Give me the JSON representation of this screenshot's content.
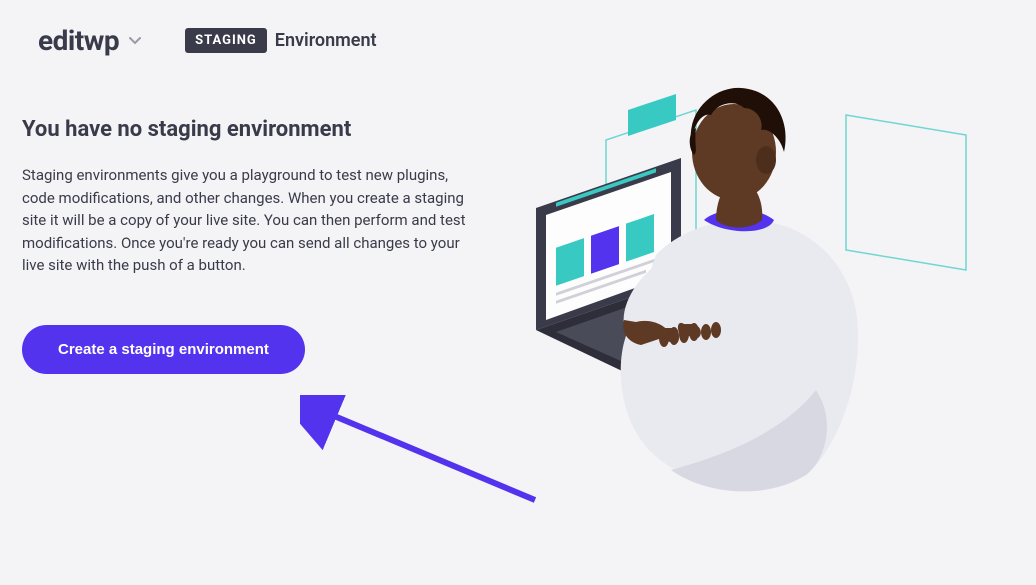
{
  "header": {
    "site_name": "editwp",
    "env_badge": "STAGING",
    "env_label": "Environment"
  },
  "main": {
    "heading": "You have no staging environment",
    "description": "Staging environments give you a playground to test new plugins, code modifications, and other changes. When you create a staging site it will be a copy of your live site. You can then perform and test modifications. Once you're ready you can send all changes to your live site with the push of a button.",
    "cta_label": "Create a staging environment"
  },
  "colors": {
    "primary": "#5333ed",
    "text_dark": "#3a3b4a",
    "bg": "#f4f4f6",
    "teal": "#37c9c2",
    "skin": "#5e3924",
    "hair": "#1f0f06",
    "shirt": "#e9e9f0",
    "laptop": "#3a3b4a"
  }
}
